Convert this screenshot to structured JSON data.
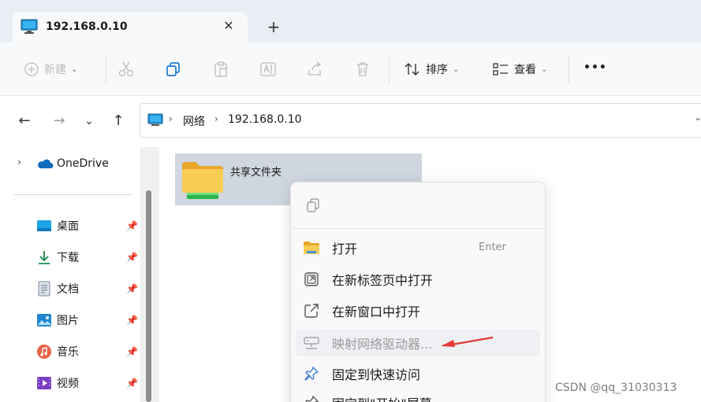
{
  "tab": {
    "title": "192.168.0.10",
    "close": "✕",
    "new_tab": "+"
  },
  "toolbar": {
    "new_label": "新建",
    "sort_label": "排序",
    "view_label": "查看",
    "more": "•••",
    "chevron": "⌄"
  },
  "nav": {
    "back": "←",
    "forward": "→",
    "recent": "⌄",
    "up": "↑"
  },
  "breadcrumb": {
    "items": [
      "网络",
      "192.168.0.10"
    ],
    "sep": "›",
    "expand": "⌄"
  },
  "sidebar": {
    "onedrive": "OneDrive",
    "expand": "›",
    "items": [
      {
        "label": "桌面",
        "icon": "desktop-icon"
      },
      {
        "label": "下载",
        "icon": "download-icon"
      },
      {
        "label": "文档",
        "icon": "document-icon"
      },
      {
        "label": "图片",
        "icon": "picture-icon"
      },
      {
        "label": "音乐",
        "icon": "music-icon"
      },
      {
        "label": "视频",
        "icon": "video-icon"
      }
    ],
    "pin": "📌"
  },
  "content": {
    "folder_name": "共享文件夹"
  },
  "context_menu": {
    "items": [
      {
        "label": "打开",
        "shortcut": "Enter",
        "icon": "folder-open-icon"
      },
      {
        "label": "在新标签页中打开",
        "icon": "new-tab-icon"
      },
      {
        "label": "在新窗口中打开",
        "icon": "new-window-icon"
      },
      {
        "label": "映射网络驱动器...",
        "icon": "network-drive-icon",
        "disabled": true
      },
      {
        "label": "固定到快速访问",
        "icon": "pin-icon"
      },
      {
        "label": "固定到\"开始\"屏幕",
        "icon": "pin-start-icon"
      }
    ]
  },
  "watermark": "CSDN @qq_31030313",
  "colors": {
    "accent": "#0067c0",
    "folder": "#f7c64b",
    "annotation_arrow": "#e53935"
  }
}
